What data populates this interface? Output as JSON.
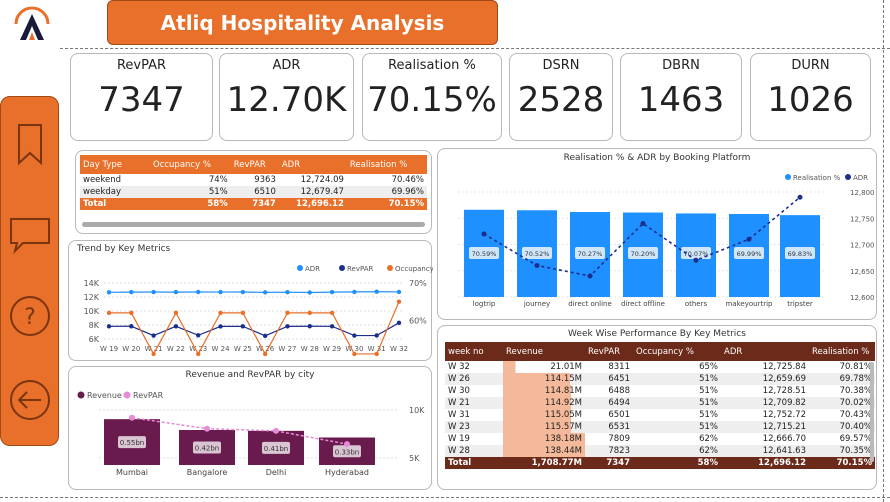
{
  "header": {
    "title": "Atliq Hospitality Analysis"
  },
  "colors": {
    "orange": "#e8702a",
    "brown": "#6b2a1a",
    "blue": "#1e90ff",
    "navy": "#1c2e8c",
    "purple": "#6a1b4d",
    "pink": "#e88ad6"
  },
  "kpis": [
    {
      "label": "RevPAR",
      "value": "7347"
    },
    {
      "label": "ADR",
      "value": "12.70K"
    },
    {
      "label": "Realisation %",
      "value": "70.15%"
    },
    {
      "label": "DSRN",
      "value": "2528"
    },
    {
      "label": "DBRN",
      "value": "1463"
    },
    {
      "label": "DURN",
      "value": "1026"
    }
  ],
  "daytype_table": {
    "headers": [
      "Day Type",
      "Occupancy %",
      "RevPAR",
      "ADR",
      "Realisation %"
    ],
    "rows": [
      [
        "weekend",
        "74%",
        "9363",
        "12,724.09",
        "70.46%"
      ],
      [
        "weekday",
        "51%",
        "6510",
        "12,679.47",
        "69.96%"
      ]
    ],
    "total": [
      "Total",
      "58%",
      "7347",
      "12,696.12",
      "70.15%"
    ]
  },
  "trend_chart": {
    "title": "Trend by Key Metrics",
    "legend": [
      "ADR",
      "RevPAR",
      "Occupancy %"
    ]
  },
  "city_chart": {
    "title": "Revenue and RevPAR by city",
    "legend": [
      "Revenue",
      "RevPAR"
    ]
  },
  "platform_chart": {
    "title": "Realisation % & ADR by Booking Platform",
    "legend": [
      "Realisation %",
      "ADR"
    ]
  },
  "week_table": {
    "title": "Week Wise Performance By Key Metrics",
    "headers": [
      "week no",
      "Revenue",
      "RevPAR",
      "Occupancy %",
      "ADR",
      "Realisation %"
    ],
    "rows": [
      [
        "W 32",
        "21.01M",
        "8311",
        "65%",
        "12,725.84",
        "70.81%"
      ],
      [
        "W 26",
        "114.15M",
        "6451",
        "51%",
        "12,659.69",
        "69.78%"
      ],
      [
        "W 30",
        "114.81M",
        "6488",
        "51%",
        "12,728.51",
        "70.38%"
      ],
      [
        "W 21",
        "114.92M",
        "6494",
        "51%",
        "12,709.82",
        "70.02%"
      ],
      [
        "W 31",
        "115.05M",
        "6501",
        "51%",
        "12,752.72",
        "70.43%"
      ],
      [
        "W 23",
        "115.57M",
        "6531",
        "51%",
        "12,715.21",
        "70.40%"
      ],
      [
        "W 19",
        "138.18M",
        "7809",
        "62%",
        "12,666.70",
        "69.57%"
      ],
      [
        "W 28",
        "138.44M",
        "7823",
        "62%",
        "12,641.63",
        "70.35%"
      ]
    ],
    "revenue_fill": [
      0.15,
      0.82,
      0.83,
      0.83,
      0.83,
      0.83,
      1.0,
      1.0
    ],
    "total": [
      "Total",
      "1,708.77M",
      "7347",
      "58%",
      "12,696.12",
      "70.15%"
    ]
  },
  "chart_data": [
    {
      "type": "line",
      "title": "Trend by Key Metrics",
      "categories": [
        "W 19",
        "W 20",
        "W 21",
        "W 22",
        "W 23",
        "W 24",
        "W 25",
        "W 26",
        "W 27",
        "W 28",
        "W 29",
        "W 30",
        "W 31",
        "W 32"
      ],
      "y_ticks": [
        "14K",
        "12K",
        "10K",
        "8K",
        "6K"
      ],
      "y2_ticks": [
        "70%",
        "60%"
      ],
      "ylim": [
        6000,
        14000
      ],
      "y2lim": [
        55,
        70
      ],
      "series": [
        {
          "name": "ADR",
          "axis": "y",
          "values": [
            12667,
            12700,
            12710,
            12700,
            12715,
            12705,
            12710,
            12660,
            12690,
            12642,
            12700,
            12729,
            12753,
            12726
          ]
        },
        {
          "name": "RevPAR",
          "axis": "y",
          "values": [
            7809,
            7820,
            6494,
            7810,
            6531,
            7800,
            7810,
            6451,
            7805,
            7823,
            7810,
            6488,
            6501,
            8311
          ]
        },
        {
          "name": "Occupancy %",
          "axis": "y2",
          "values": [
            62,
            62,
            51,
            62,
            51,
            62,
            62,
            51,
            62,
            62,
            62,
            51,
            51,
            65
          ]
        }
      ]
    },
    {
      "type": "bar",
      "title": "Revenue and RevPAR by city",
      "categories": [
        "Mumbai",
        "Bangalore",
        "Delhi",
        "Hyderabad"
      ],
      "series": [
        {
          "name": "Revenue",
          "values": [
            0.55,
            0.42,
            0.41,
            0.33
          ],
          "labels": [
            "0.55bn",
            "0.42bn",
            "0.41bn",
            "0.33bn"
          ]
        },
        {
          "name": "RevPAR",
          "values": [
            9300,
            8300,
            8100,
            6900
          ]
        }
      ],
      "y2_ticks": [
        "10K",
        "5K"
      ]
    },
    {
      "type": "bar",
      "title": "Realisation % & ADR by Booking Platform",
      "categories": [
        "logtrip",
        "journey",
        "direct online",
        "direct offline",
        "others",
        "makeyourtrip",
        "tripster"
      ],
      "series": [
        {
          "name": "Realisation %",
          "values": [
            70.59,
            70.52,
            70.27,
            70.2,
            70.07,
            69.99,
            69.83
          ],
          "labels": [
            "70.59%",
            "70.52%",
            "70.27%",
            "70.20%",
            "70.07%",
            "69.99%",
            "69.83%"
          ]
        },
        {
          "name": "ADR",
          "values": [
            12720,
            12660,
            12640,
            12740,
            12670,
            12710,
            12790
          ]
        }
      ],
      "y2_ticks": [
        "12,800",
        "12,750",
        "12,700",
        "12,650",
        "12,600"
      ],
      "y2lim": [
        12600,
        12800
      ]
    }
  ]
}
